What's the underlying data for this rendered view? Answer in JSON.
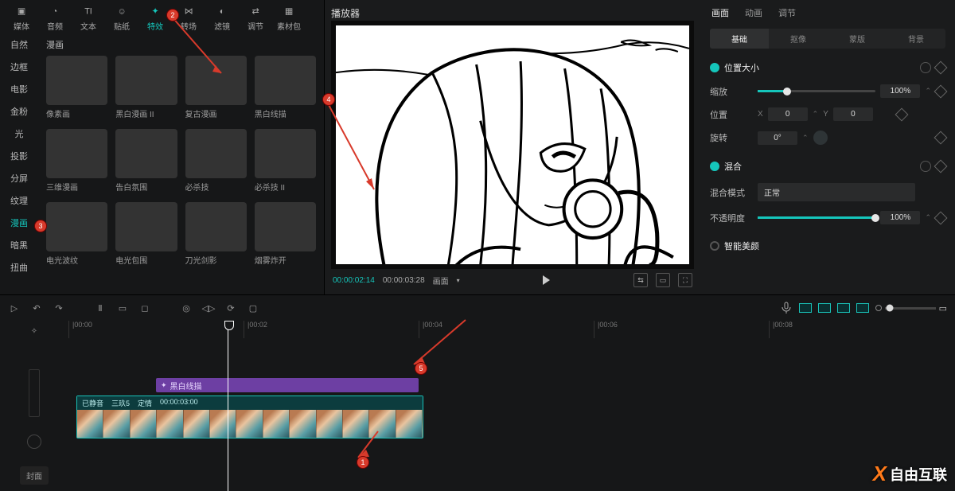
{
  "topTabs": [
    {
      "label": "媒体"
    },
    {
      "label": "音频"
    },
    {
      "label": "文本"
    },
    {
      "label": "贴纸"
    },
    {
      "label": "特效",
      "active": true
    },
    {
      "label": "转场"
    },
    {
      "label": "滤镜"
    },
    {
      "label": "调节"
    },
    {
      "label": "素材包"
    }
  ],
  "categories": [
    {
      "label": "自然"
    },
    {
      "label": "边框"
    },
    {
      "label": "电影"
    },
    {
      "label": "金粉"
    },
    {
      "label": "光"
    },
    {
      "label": "投影"
    },
    {
      "label": "分屏"
    },
    {
      "label": "纹理"
    },
    {
      "label": "漫画",
      "active": true
    },
    {
      "label": "暗黑"
    },
    {
      "label": "扭曲"
    }
  ],
  "gridTitle": "漫画",
  "effects": [
    {
      "label": "像素画",
      "cls": "swirl"
    },
    {
      "label": "黑白漫画 II",
      "cls": "bwsk"
    },
    {
      "label": "复古漫画",
      "cls": "retro"
    },
    {
      "label": "黑白线描",
      "cls": "bwsk"
    },
    {
      "label": "三维漫画",
      "cls": "panels"
    },
    {
      "label": "告白氛围",
      "cls": "fglow"
    },
    {
      "label": "必杀技",
      "cls": "glowb"
    },
    {
      "label": "必杀技 II",
      "cls": "glowb"
    },
    {
      "label": "电光波纹",
      "cls": "glowb"
    },
    {
      "label": "电光包围",
      "cls": "glowb"
    },
    {
      "label": "刀光剑影",
      "cls": "fglow"
    },
    {
      "label": "烟雾炸开",
      "cls": "expl"
    }
  ],
  "preview": {
    "title": "播放器",
    "timeCur": "00:00:02:14",
    "timeTot": "00:00:03:28",
    "mode": "画面"
  },
  "props": {
    "tabs": [
      {
        "label": "画面",
        "active": true
      },
      {
        "label": "动画"
      },
      {
        "label": "调节"
      }
    ],
    "subtabs": [
      {
        "label": "基础",
        "active": true
      },
      {
        "label": "抠像"
      },
      {
        "label": "蒙版"
      },
      {
        "label": "背景"
      }
    ],
    "sec1": "位置大小",
    "scale": {
      "label": "缩放",
      "val": "100%"
    },
    "pos": {
      "label": "位置",
      "x": "0",
      "y": "0"
    },
    "rot": {
      "label": "旋转",
      "val": "0°"
    },
    "sec2": "混合",
    "mode": {
      "label": "混合模式",
      "val": "正常"
    },
    "opa": {
      "label": "不透明度",
      "val": "100%"
    },
    "beauty": "智能美颜"
  },
  "timeline": {
    "ruler": [
      "|00:00",
      "|00:02",
      "|00:04",
      "|00:06",
      "|00:08"
    ],
    "fxLabel": "黑白线描",
    "clip": {
      "mute": "已静音",
      "name": "三玖5",
      "expr": "定情",
      "dur": "00:00:03:00"
    },
    "cover": "封面",
    "frames": 13
  },
  "annotations": {
    "1": "1",
    "2": "2",
    "3": "3",
    "4": "4",
    "5": "5"
  },
  "watermark": "自由互联"
}
